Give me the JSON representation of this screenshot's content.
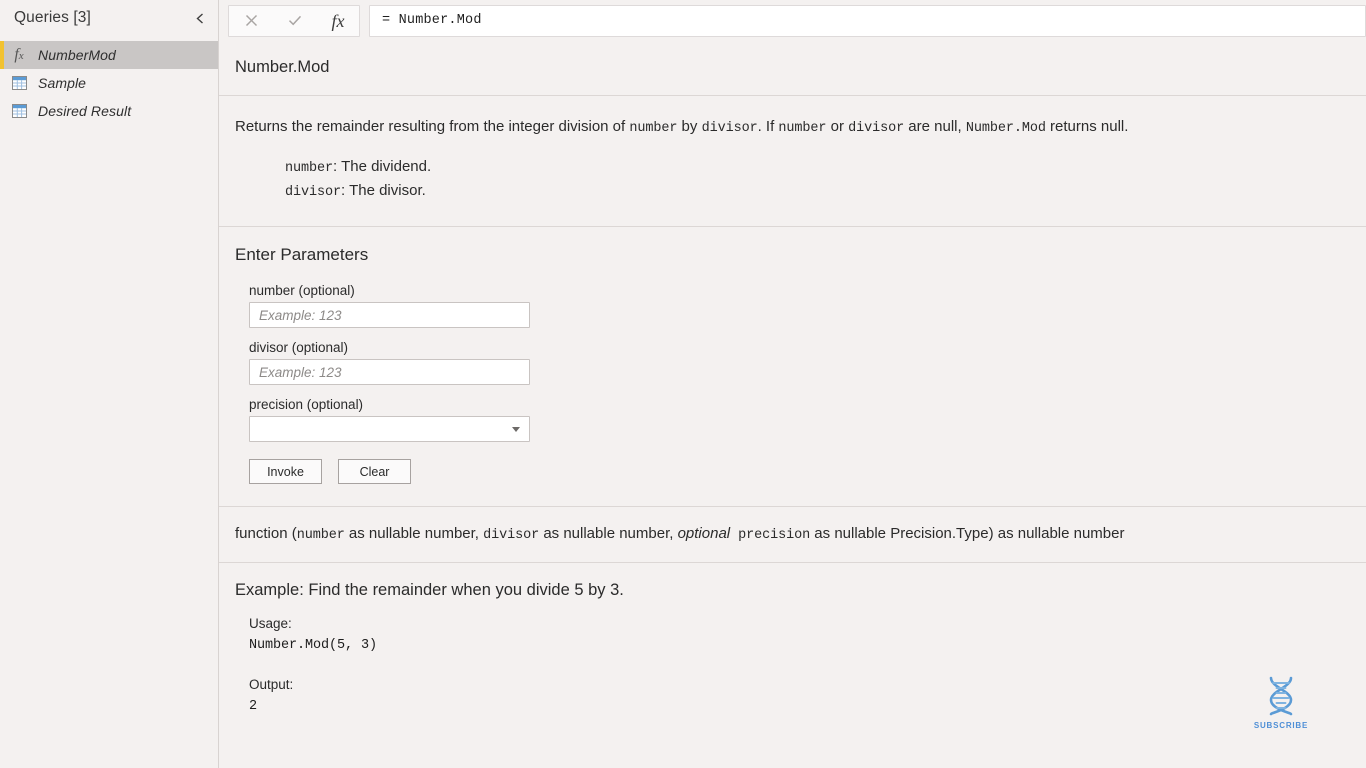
{
  "sidebar": {
    "header_title": "Queries [3]",
    "collapse_icon": "chevron-left-icon",
    "items": [
      {
        "label": "NumberMod",
        "icon": "fx-icon",
        "selected": true
      },
      {
        "label": "Sample",
        "icon": "table-icon",
        "selected": false
      },
      {
        "label": "Desired Result",
        "icon": "table-icon",
        "selected": false
      }
    ]
  },
  "formula_bar": {
    "cancel_icon": "close-icon",
    "accept_icon": "checkmark-icon",
    "fx_icon": "fx-icon",
    "fx_label": "fx",
    "value": "= Number.Mod"
  },
  "function_header": {
    "name": "Number.Mod"
  },
  "description": {
    "part1": "Returns the remainder resulting from the integer division of ",
    "code1": "number",
    "part2": " by ",
    "code2": "divisor",
    "part3": ". If ",
    "code3": "number",
    "part4": " or ",
    "code4": "divisor",
    "part5": " are null, ",
    "code5": "Number.Mod",
    "part6": " returns null.",
    "params": [
      {
        "name": "number",
        "text": ": The dividend."
      },
      {
        "name": "divisor",
        "text": ": The divisor."
      }
    ]
  },
  "enter_parameters": {
    "title": "Enter Parameters",
    "fields": [
      {
        "label": "number (optional)",
        "value": "",
        "placeholder": "Example: 123",
        "type": "text"
      },
      {
        "label": "divisor (optional)",
        "value": "",
        "placeholder": "Example: 123",
        "type": "text"
      },
      {
        "label": "precision (optional)",
        "value": "",
        "placeholder": "",
        "type": "select"
      }
    ],
    "invoke_label": "Invoke",
    "clear_label": "Clear"
  },
  "signature": {
    "s1": "function (",
    "c1": "number",
    "s2": " as nullable number, ",
    "c2": "divisor",
    "s3": " as nullable number, ",
    "i1": "optional",
    "c3": " precision",
    "s4": " as nullable Precision.Type) as nullable number"
  },
  "example": {
    "title": "Example: Find the remainder when you divide 5 by 3.",
    "usage_label": "Usage:",
    "usage_code": "Number.Mod(5, 3)",
    "output_label": "Output:",
    "output_code": "2"
  },
  "watermark": {
    "icon": "dna-helix-icon",
    "text": "SUBSCRIBE",
    "color": "#4f8fd6"
  }
}
